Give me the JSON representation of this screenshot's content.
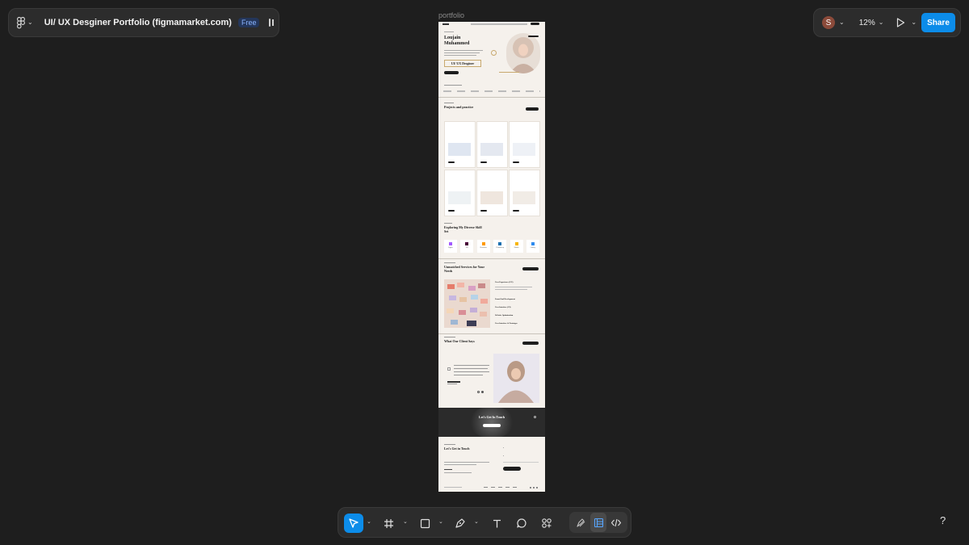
{
  "file": {
    "title": "UI/ UX Desginer Portfolio (figmamarket.com)",
    "plan_badge": "Free"
  },
  "header_right": {
    "avatar_initial": "S",
    "zoom": "12%",
    "share_label": "Share"
  },
  "canvas": {
    "frame_label": "portfolio"
  },
  "portfolio": {
    "hero_name": "Loujain Muhammed",
    "hero_role": "UI/ UX Desginer",
    "projects_heading": "Projects and practice",
    "skills_heading": "Exploring My Diverse Skill Set",
    "skills": [
      "Figma",
      "XD",
      "Illustrator",
      "Photoshop",
      "Sketch",
      "Lunacy"
    ],
    "services_heading": "Unmatched Services for Your Needs",
    "services": [
      "User Experience (UX)",
      "Front-End Development",
      "User Interface (UI)",
      "Website Optimization",
      "User Interface & Prototype"
    ],
    "testimonials_heading": "What Our Client Says",
    "cta_banner": "Let's Get In Touch",
    "contact_heading": "Let's Get in Touch"
  },
  "toolbar": {
    "tools": [
      "move-tool",
      "frame-tool",
      "shape-tool",
      "pen-tool",
      "text-tool",
      "comment-tool",
      "actions-tool"
    ],
    "modes": [
      "draw-mode",
      "design-mode",
      "dev-mode"
    ]
  },
  "help": {
    "label": "?"
  },
  "colors": {
    "canvas_bg": "#1e1e1e",
    "panel_bg": "#2c2c2c",
    "accent_blue": "#0c8ce9",
    "frame_bg": "#f5f1ec",
    "dark_band": "#2a2a2a"
  }
}
